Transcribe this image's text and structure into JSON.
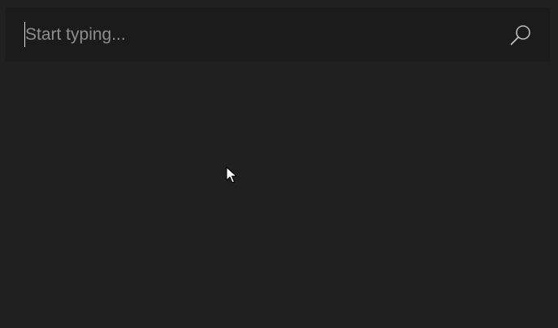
{
  "search": {
    "value": "",
    "placeholder": "Start typing..."
  },
  "icons": {
    "search": "search-icon",
    "pointer": "mouse-pointer-icon"
  },
  "colors": {
    "background": "#202020",
    "search_bar": "#1b1b1b",
    "placeholder": "#8e8e8e",
    "icon": "#bdbdbd"
  }
}
